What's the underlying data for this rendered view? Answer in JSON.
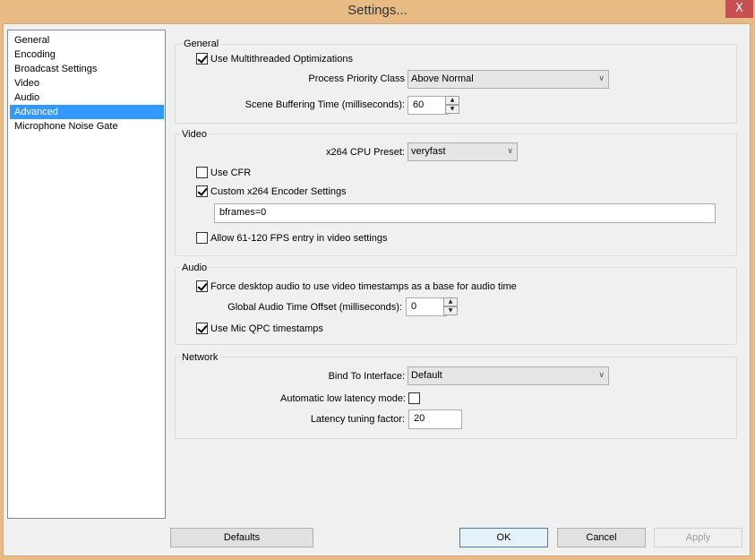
{
  "window": {
    "title": "Settings...",
    "close_label": "X"
  },
  "sidebar": {
    "items": [
      {
        "label": "General",
        "selected": false
      },
      {
        "label": "Encoding",
        "selected": false
      },
      {
        "label": "Broadcast Settings",
        "selected": false
      },
      {
        "label": "Video",
        "selected": false
      },
      {
        "label": "Audio",
        "selected": false
      },
      {
        "label": "Advanced",
        "selected": true
      },
      {
        "label": "Microphone Noise Gate",
        "selected": false
      }
    ]
  },
  "general": {
    "group_label": "General",
    "multithreaded": {
      "label": "Use Multithreaded Optimizations",
      "checked": true
    },
    "priority": {
      "label": "Process Priority Class",
      "value": "Above Normal"
    },
    "buffering": {
      "label": "Scene Buffering Time (milliseconds):",
      "value": "60"
    }
  },
  "video": {
    "group_label": "Video",
    "preset": {
      "label": "x264 CPU Preset:",
      "value": "veryfast"
    },
    "use_cfr": {
      "label": "Use CFR",
      "checked": false
    },
    "custom_x264": {
      "label": "Custom x264 Encoder Settings",
      "checked": true
    },
    "custom_x264_value": "bframes=0",
    "allow_high_fps": {
      "label": "Allow 61-120 FPS entry in video settings",
      "checked": false
    }
  },
  "audio": {
    "group_label": "Audio",
    "force_desktop": {
      "label": "Force desktop audio to use video timestamps as a base for audio time",
      "checked": true
    },
    "offset": {
      "label": "Global Audio Time Offset (milliseconds):",
      "value": "0"
    },
    "mic_qpc": {
      "label": "Use Mic QPC timestamps",
      "checked": true
    }
  },
  "network": {
    "group_label": "Network",
    "bind": {
      "label": "Bind To Interface:",
      "value": "Default"
    },
    "low_latency": {
      "label": "Automatic low latency mode:",
      "checked": false
    },
    "latency_factor": {
      "label": "Latency tuning factor:",
      "value": "20"
    }
  },
  "footer": {
    "defaults": "Defaults",
    "ok": "OK",
    "cancel": "Cancel",
    "apply": "Apply"
  },
  "icons": {
    "dropdown_arrow": "∨",
    "spin_up": "▲",
    "spin_down": "▼"
  }
}
